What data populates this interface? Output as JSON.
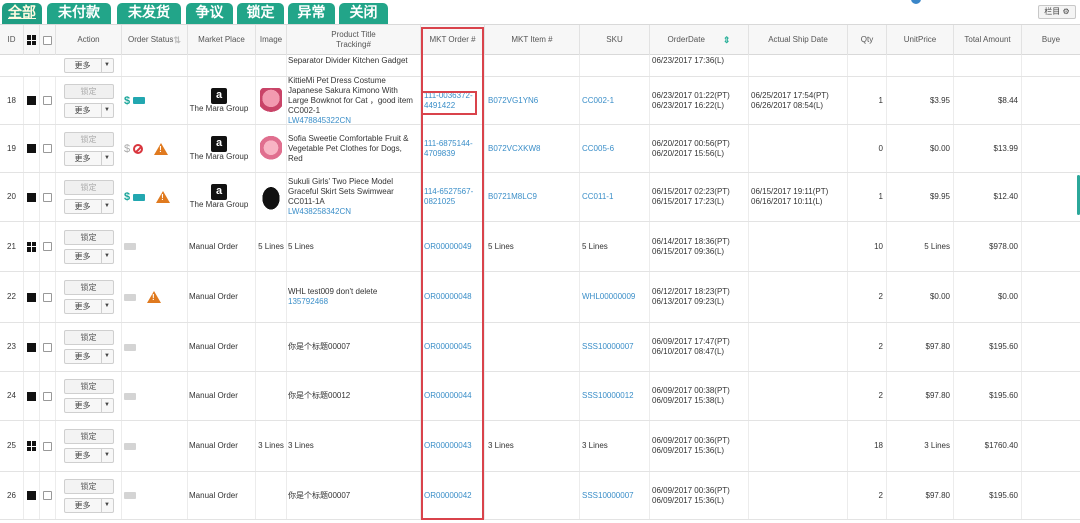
{
  "tabs": [
    {
      "label": "全部",
      "active": true
    },
    {
      "label": "未付款",
      "active": false
    },
    {
      "label": "未发货",
      "active": false
    },
    {
      "label": "争议",
      "active": false
    },
    {
      "label": "锁定",
      "active": false
    },
    {
      "label": "异常",
      "active": false
    },
    {
      "label": "关闭",
      "active": false
    }
  ],
  "column_settings_label": "栏目",
  "columns": {
    "id": "ID",
    "action": "Action",
    "order_status": "Order Status",
    "market_place": "Market Place",
    "image": "Image",
    "product_title": "Product Title",
    "tracking": "Tracking#",
    "mkt_order": "MKT Order #",
    "mkt_item": "MKT Item #",
    "sku": "SKU",
    "order_date": "OrderDate",
    "actual_ship_date": "Actual Ship Date",
    "qty": "Qty",
    "unit_price": "UnitPrice",
    "total_amount": "Total Amount",
    "buyer": "Buye"
  },
  "buttons": {
    "lock": "锁定",
    "more": "更多",
    "more_arrow": "▼"
  },
  "top_partial_row": {
    "title": "Separator Divider Kitchen Gadget",
    "order_date": "06/23/2017 17:36(L)"
  },
  "rows": [
    {
      "id": "18",
      "grid_icon": false,
      "lock_disabled": true,
      "status": {
        "paid": true,
        "shipped": true,
        "blocked": false,
        "warning": false
      },
      "market_place": "The Mara Group",
      "amazon": true,
      "image": "pink",
      "title": "KittieMi Pet Dress Costume Japanese Sakura Kimono With Large Bowknot for Cat ，good item CC002-1",
      "tracking": "LW478845322CN",
      "mkt_order": "111-0036372-4491422",
      "mkt_item": "B072VG1YN6",
      "sku": "CC002-1",
      "order_date_pt": "06/23/2017 01:22(PT)",
      "order_date_l": "06/23/2017 16:22(L)",
      "ship_date_pt": "06/25/2017 17:54(PT)",
      "ship_date_l": "06/26/2017 08:54(L)",
      "qty": "1",
      "unit_price": "$3.95",
      "total": "$8.44"
    },
    {
      "id": "19",
      "grid_icon": false,
      "lock_disabled": true,
      "status": {
        "paid": false,
        "shipped": false,
        "blocked": true,
        "warning": true
      },
      "market_place": "The Mara Group",
      "amazon": true,
      "image": "dog",
      "title": "Sofia Sweetie Comfortable Fruit & Vegetable Pet Clothes for Dogs, Red",
      "tracking": "",
      "mkt_order": "111-6875144-4709839",
      "mkt_item": "B072VCXKW8",
      "sku": "CC005-6",
      "order_date_pt": "06/20/2017 00:56(PT)",
      "order_date_l": "06/20/2017 15:56(L)",
      "ship_date_pt": "",
      "ship_date_l": "",
      "qty": "0",
      "unit_price": "$0.00",
      "total": "$13.99"
    },
    {
      "id": "20",
      "grid_icon": false,
      "lock_disabled": true,
      "status": {
        "paid": true,
        "shipped": true,
        "blocked": false,
        "warning": true
      },
      "market_place": "The Mara Group",
      "amazon": true,
      "image": "black",
      "title": "Sukuli Girls' Two Piece Model Graceful Skirt Sets Swimwear CC011-1A",
      "tracking": "LW438258342CN",
      "mkt_order": "114-6527567-0821025",
      "mkt_item": "B0721M8LC9",
      "sku": "CC011-1",
      "order_date_pt": "06/15/2017 02:23(PT)",
      "order_date_l": "06/15/2017 17:23(L)",
      "ship_date_pt": "06/15/2017 19:11(PT)",
      "ship_date_l": "06/16/2017 10:11(L)",
      "qty": "1",
      "unit_price": "$9.95",
      "total": "$12.40"
    },
    {
      "id": "21",
      "grid_icon": true,
      "lock_disabled": false,
      "status": {
        "paid": false,
        "shipped": false,
        "blocked": false,
        "warning": false
      },
      "market_place": "Manual Order",
      "amazon": false,
      "image_text": "5 Lines",
      "title": "5 Lines",
      "tracking": "",
      "mkt_order": "OR00000049",
      "mkt_item": "5 Lines",
      "sku": "5 Lines",
      "sku_plain": true,
      "item_plain": true,
      "order_date_pt": "06/14/2017 18:36(PT)",
      "order_date_l": "06/15/2017 09:36(L)",
      "ship_date_pt": "",
      "ship_date_l": "",
      "qty": "10",
      "unit_price": "5 Lines",
      "total": "$978.00"
    },
    {
      "id": "22",
      "grid_icon": false,
      "lock_disabled": false,
      "status": {
        "paid": false,
        "shipped": false,
        "blocked": false,
        "warning": true
      },
      "market_place": "Manual Order",
      "amazon": false,
      "title": "WHL test009 don't delete",
      "tracking": "135792468",
      "mkt_order": "OR00000048",
      "mkt_item": "",
      "sku": "WHL00000009",
      "order_date_pt": "06/12/2017 18:23(PT)",
      "order_date_l": "06/13/2017 09:23(L)",
      "ship_date_pt": "",
      "ship_date_l": "",
      "qty": "2",
      "unit_price": "$0.00",
      "total": "$0.00"
    },
    {
      "id": "23",
      "grid_icon": false,
      "lock_disabled": false,
      "status": {
        "paid": false,
        "shipped": false,
        "blocked": false,
        "warning": false
      },
      "market_place": "Manual Order",
      "amazon": false,
      "title": "你是个标题00007",
      "tracking": "",
      "mkt_order": "OR00000045",
      "mkt_item": "",
      "sku": "SSS10000007",
      "order_date_pt": "06/09/2017 17:47(PT)",
      "order_date_l": "06/10/2017 08:47(L)",
      "ship_date_pt": "",
      "ship_date_l": "",
      "qty": "2",
      "unit_price": "$97.80",
      "total": "$195.60"
    },
    {
      "id": "24",
      "grid_icon": false,
      "lock_disabled": false,
      "status": {
        "paid": false,
        "shipped": false,
        "blocked": false,
        "warning": false
      },
      "market_place": "Manual Order",
      "amazon": false,
      "title": "你是个标题00012",
      "tracking": "",
      "mkt_order": "OR00000044",
      "mkt_item": "",
      "sku": "SSS10000012",
      "order_date_pt": "06/09/2017 00:38(PT)",
      "order_date_l": "06/09/2017 15:38(L)",
      "ship_date_pt": "",
      "ship_date_l": "",
      "qty": "2",
      "unit_price": "$97.80",
      "total": "$195.60"
    },
    {
      "id": "25",
      "grid_icon": true,
      "lock_disabled": false,
      "status": {
        "paid": false,
        "shipped": false,
        "blocked": false,
        "warning": false
      },
      "market_place": "Manual Order",
      "amazon": false,
      "image_text": "3 Lines",
      "title": "3 Lines",
      "tracking": "",
      "mkt_order": "OR00000043",
      "mkt_item": "3 Lines",
      "sku": "3 Lines",
      "sku_plain": true,
      "item_plain": true,
      "order_date_pt": "06/09/2017 00:36(PT)",
      "order_date_l": "06/09/2017 15:36(L)",
      "ship_date_pt": "",
      "ship_date_l": "",
      "qty": "18",
      "unit_price": "3 Lines",
      "total": "$1760.40"
    },
    {
      "id": "26",
      "grid_icon": false,
      "lock_disabled": false,
      "status": {
        "paid": false,
        "shipped": false,
        "blocked": false,
        "warning": false
      },
      "market_place": "Manual Order",
      "amazon": false,
      "title": "你是个标题00007",
      "tracking": "",
      "mkt_order": "OR00000042",
      "mkt_item": "",
      "sku": "SSS10000007",
      "order_date_pt": "06/09/2017 00:36(PT)",
      "order_date_l": "06/09/2017 15:36(L)",
      "ship_date_pt": "",
      "ship_date_l": "",
      "qty": "2",
      "unit_price": "$97.80",
      "total": "$195.60"
    }
  ],
  "colors": {
    "tab": "#22a589",
    "link": "#3a8ec8",
    "highlight": "#d9434b",
    "warning": "#e07a1f"
  }
}
